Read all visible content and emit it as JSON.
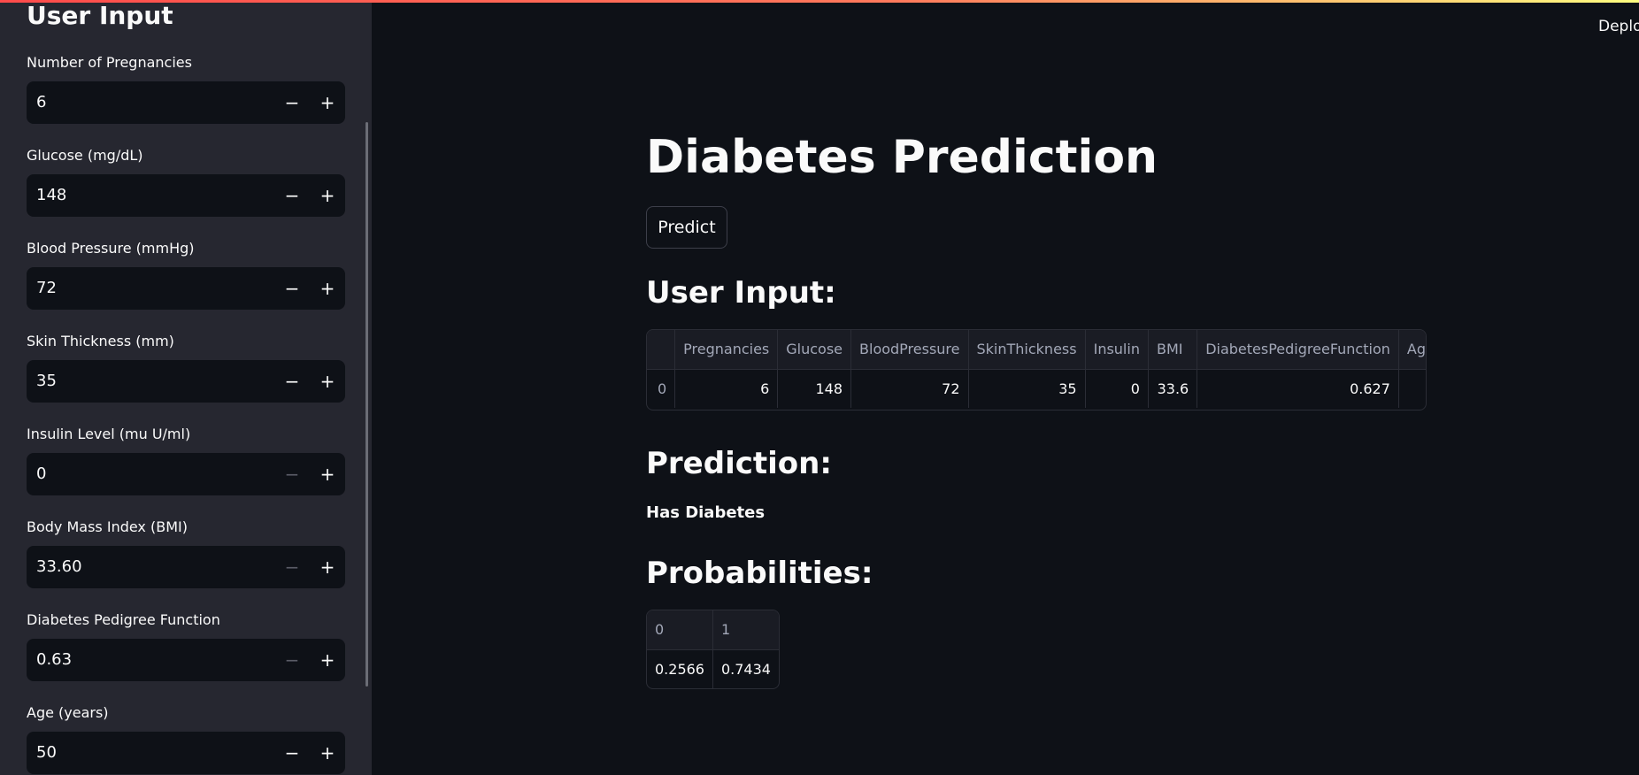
{
  "sidebar": {
    "title": "User Input",
    "fields": [
      {
        "label": "Number of Pregnancies",
        "value": "6",
        "minus_disabled": false
      },
      {
        "label": "Glucose (mg/dL)",
        "value": "148",
        "minus_disabled": false
      },
      {
        "label": "Blood Pressure (mmHg)",
        "value": "72",
        "minus_disabled": false
      },
      {
        "label": "Skin Thickness (mm)",
        "value": "35",
        "minus_disabled": false
      },
      {
        "label": "Insulin Level (mu U/ml)",
        "value": "0",
        "minus_disabled": true
      },
      {
        "label": "Body Mass Index (BMI)",
        "value": "33.60",
        "minus_disabled": true
      },
      {
        "label": "Diabetes Pedigree Function",
        "value": "0.63",
        "minus_disabled": true
      },
      {
        "label": "Age (years)",
        "value": "50",
        "minus_disabled": false
      }
    ],
    "minus_symbol": "−",
    "plus_symbol": "+"
  },
  "header": {
    "deploy_label": "Deploy"
  },
  "main": {
    "title": "Diabetes Prediction",
    "predict_label": "Predict",
    "user_input_heading": "User Input:",
    "user_input_table": {
      "columns": [
        "",
        "Pregnancies",
        "Glucose",
        "BloodPressure",
        "SkinThickness",
        "Insulin",
        "BMI",
        "DiabetesPedigreeFunction",
        "Ag"
      ],
      "rows": [
        [
          "0",
          "6",
          "148",
          "72",
          "35",
          "0",
          "33.6",
          "0.627",
          ""
        ]
      ]
    },
    "prediction_heading": "Prediction:",
    "prediction_result": "Has Diabetes",
    "probabilities_heading": "Probabilities:",
    "probabilities_table": {
      "columns": [
        "0",
        "1"
      ],
      "rows": [
        [
          "0.2566",
          "0.7434"
        ]
      ]
    }
  },
  "colors": {
    "background": "#0e1117",
    "sidebar": "#262730",
    "accent_start": "#ff4b4b",
    "accent_end": "#fffd80"
  }
}
